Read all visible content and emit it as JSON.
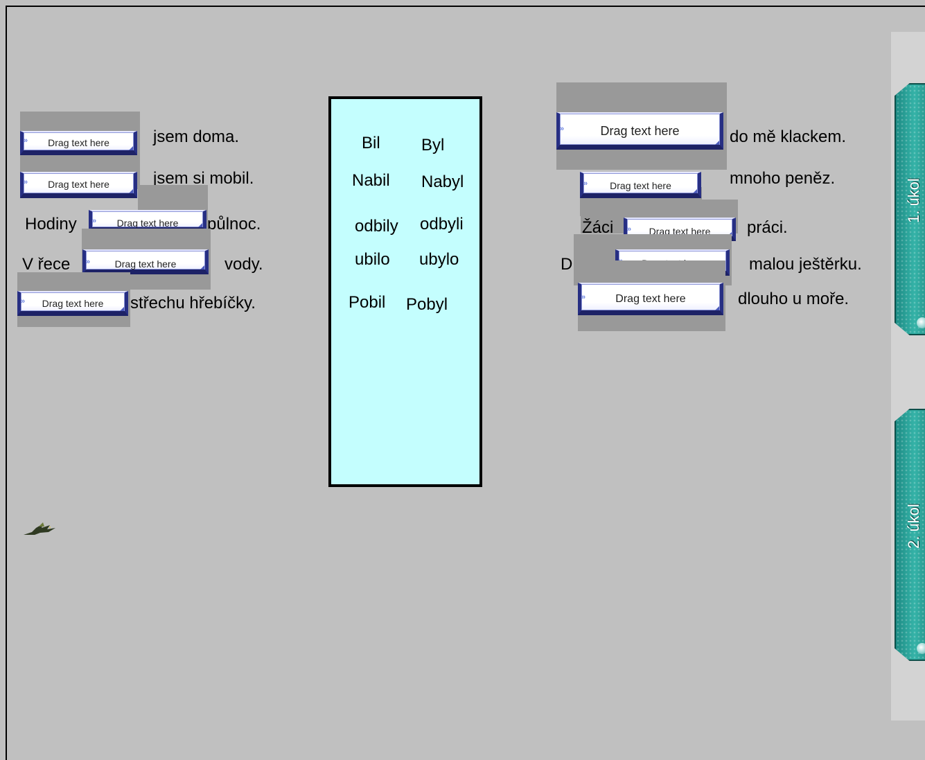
{
  "drop_placeholder": "Drag text here",
  "left_sentences": [
    {
      "prefix": "",
      "suffix": "jsem doma."
    },
    {
      "prefix": "",
      "suffix": "jsem si mobil."
    },
    {
      "prefix": "Hodiny",
      "suffix": "půlnoc."
    },
    {
      "prefix": "V řece",
      "suffix": "vody."
    },
    {
      "prefix": "",
      "suffix": "střechu hřebíčky."
    }
  ],
  "right_sentences": [
    {
      "prefix": "",
      "suffix": "do mě klackem."
    },
    {
      "prefix": "",
      "suffix": "mnoho peněz."
    },
    {
      "prefix": "Žáci",
      "suffix": "práci."
    },
    {
      "prefix": "Dítě",
      "suffix": "malou ještěrku."
    },
    {
      "prefix": "",
      "suffix": "dlouho u moře."
    }
  ],
  "word_bank": [
    "Bil",
    "Byl",
    "Nabil",
    "Nabyl",
    "odbily",
    "odbyli",
    "ubilo",
    "ubylo",
    "Pobil",
    "Pobyl"
  ],
  "tabs": [
    {
      "label": "1. úkol"
    },
    {
      "label": "2. úkol"
    }
  ],
  "colors": {
    "background": "#c0c0c0",
    "word_bank_bg": "#c4fefe",
    "tab_teal": "#2aa39a",
    "drop_border": "#272f83"
  },
  "icons": {
    "decor": "dragon-icon",
    "drop_arrow": "chevron-right-icon"
  }
}
